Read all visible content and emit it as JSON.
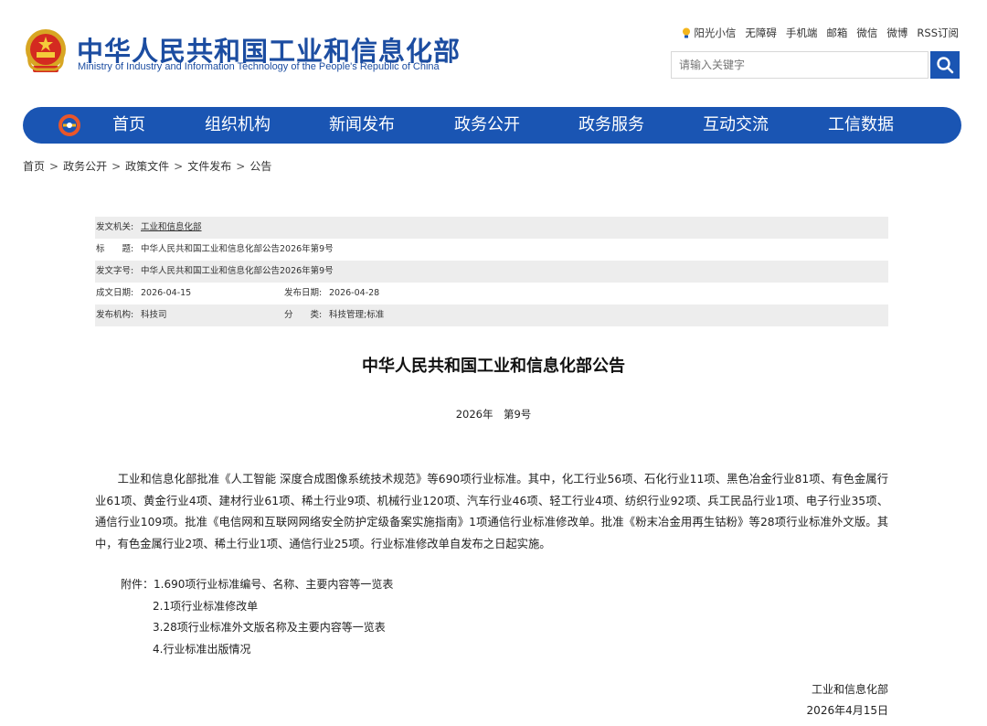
{
  "header": {
    "title_cn": "中华人民共和国工业和信息化部",
    "title_en": "Ministry of Industry and Information Technology of the People's Republic of China",
    "emblem_icon": "national-emblem-icon"
  },
  "toplinks": [
    "阳光小信",
    "无障碍",
    "手机端",
    "邮箱",
    "微信",
    "微博",
    "RSS订阅"
  ],
  "search": {
    "placeholder": "请输入关键字",
    "button_icon": "search-icon"
  },
  "nav": {
    "items": [
      "首页",
      "组织机构",
      "新闻发布",
      "政务公开",
      "政务服务",
      "互动交流",
      "工信数据"
    ]
  },
  "breadcrumb": [
    "首页",
    "政务公开",
    "政策文件",
    "文件发布",
    "公告"
  ],
  "meta": {
    "issuer_label": "发文机关:",
    "issuer": "工业和信息化部",
    "title_label": "标　　题:",
    "title": "中华人民共和国工业和信息化部公告2026年第9号",
    "doc_no_label": "发文字号:",
    "doc_no": "中华人民共和国工业和信息化部公告2026年第9号",
    "written_label": "成文日期:",
    "written": "2026-04-15",
    "published_label": "发布日期:",
    "published": "2026-04-28",
    "org_label": "发布机构:",
    "org": "科技司",
    "category_label": "分　　类:",
    "category": "科技管理;标准"
  },
  "document": {
    "title": "中华人民共和国工业和信息化部公告",
    "number": "2026年　第9号",
    "body": "工业和信息化部批准《人工智能 深度合成图像系统技术规范》等690项行业标准。其中，化工行业56项、石化行业11项、黑色冶金行业81项、有色金属行业61项、黄金行业4项、建材行业61项、稀土行业9项、机械行业120项、汽车行业46项、轻工行业4项、纺织行业92项、兵工民品行业1项、电子行业35项、通信行业109项。批准《电信网和互联网网络安全防护定级备案实施指南》1项通信行业标准修改单。批准《粉末冶金用再生钴粉》等28项行业标准外文版。其中，有色金属行业2项、稀土行业1项、通信行业25项。行业标准修改单自发布之日起实施。",
    "attachments": [
      "附件：1.690项行业标准编号、名称、主要内容等一览表",
      "2.1项行业标准修改单",
      "3.28项行业标准外文版名称及主要内容等一览表",
      "4.行业标准出版情况"
    ],
    "sign_org": "工业和信息化部",
    "sign_date": "2026年4月15日"
  },
  "colors": {
    "brand_blue": "#1a55b3",
    "title_blue": "#1c4da1",
    "meta_shade": "#ededed"
  }
}
